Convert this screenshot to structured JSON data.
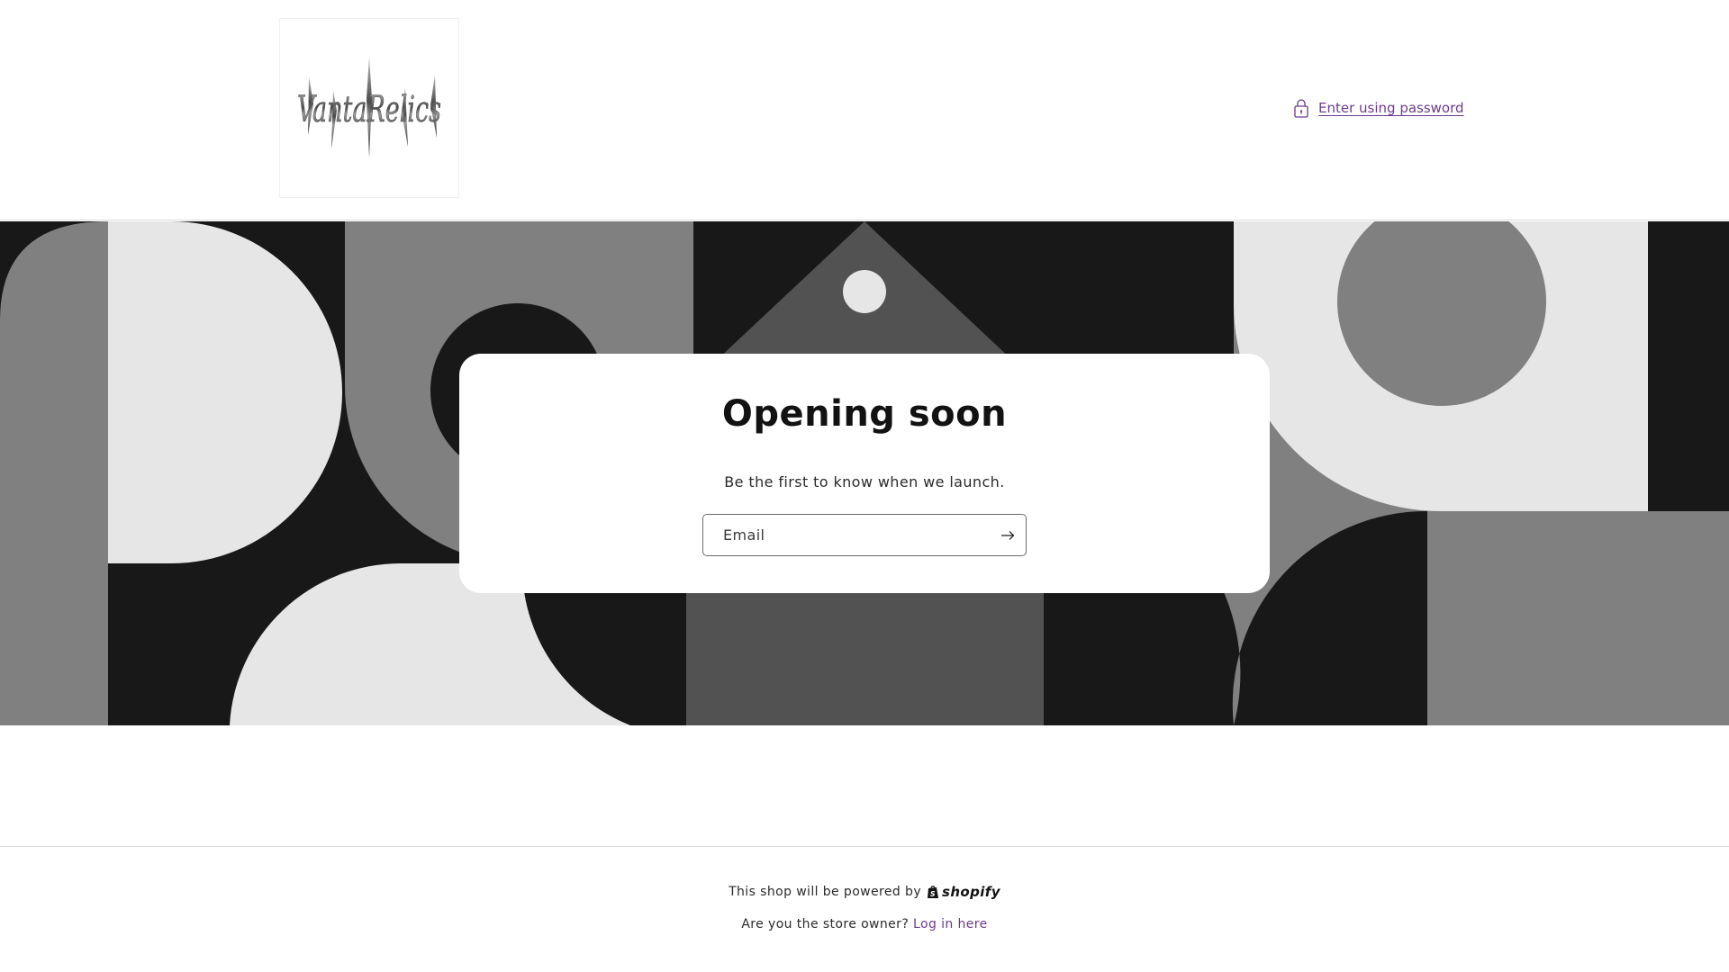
{
  "header": {
    "logo_text": "VantaRelics",
    "password_link_label": "Enter using password",
    "lock_icon": "lock-icon"
  },
  "banner": {
    "title": "Opening soon",
    "subtitle": "Be the first to know when we launch.",
    "email_placeholder": "Email",
    "submit_icon": "arrow-right-icon"
  },
  "footer": {
    "powered_text": "This shop will be powered by",
    "shopify_label": "shopify",
    "owner_question": "Are you the store owner?",
    "login_link": "Log in here"
  },
  "colors": {
    "accent": "#6d3b8c",
    "dark": "#181818",
    "mid": "#808080",
    "charcoal": "#525252",
    "light": "#e6e6e6"
  }
}
